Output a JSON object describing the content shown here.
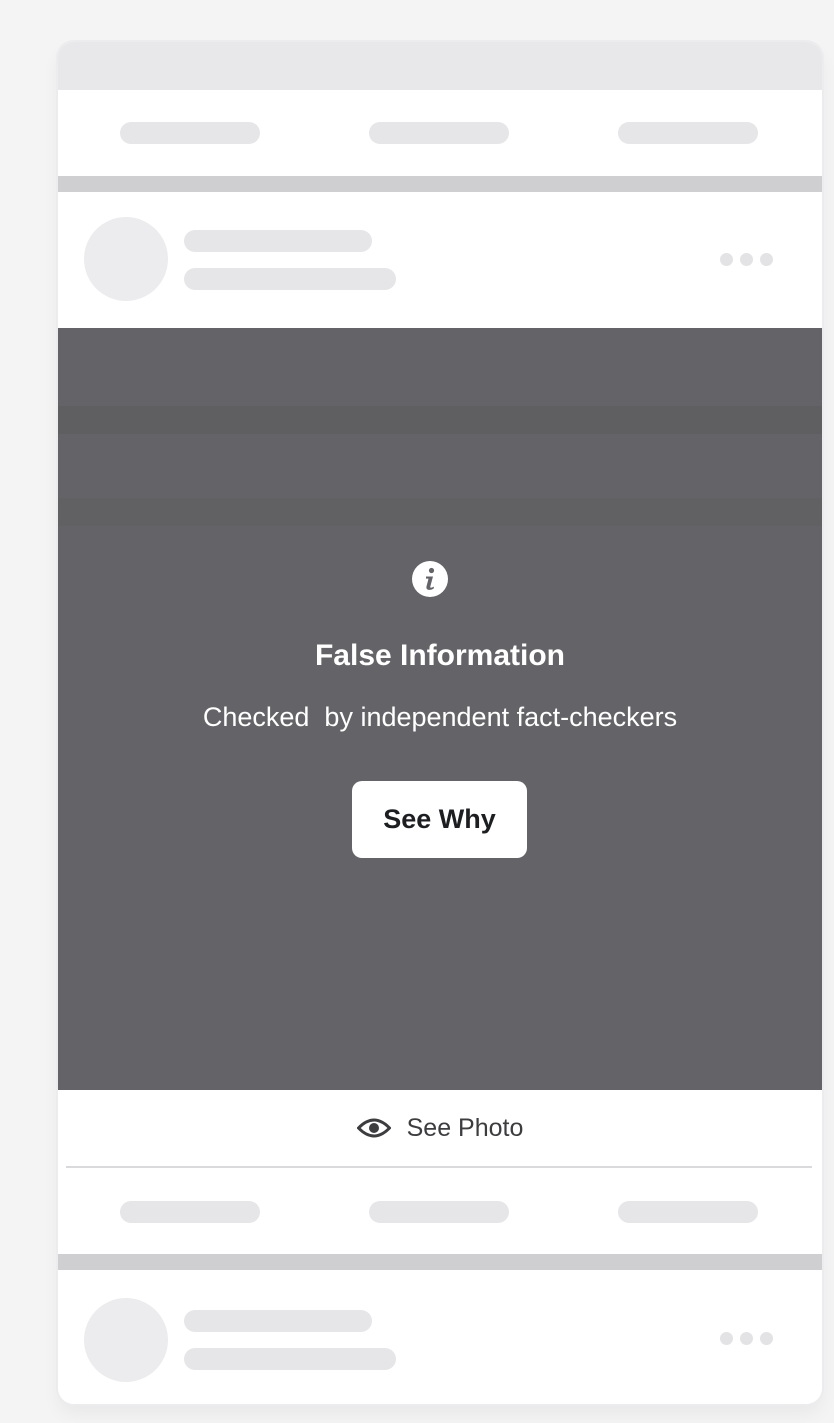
{
  "warning": {
    "icon": "info-icon",
    "title": "False Information",
    "subtitle": "Checked  by independent fact-checkers",
    "button_label": "See Why"
  },
  "photo_toggle": {
    "icon": "eye-icon",
    "label": "See Photo"
  },
  "colors": {
    "overlay": "#646468",
    "button_text": "#1c1e21",
    "placeholder": "#e6e6e8",
    "separator": "#cfcfd1"
  }
}
